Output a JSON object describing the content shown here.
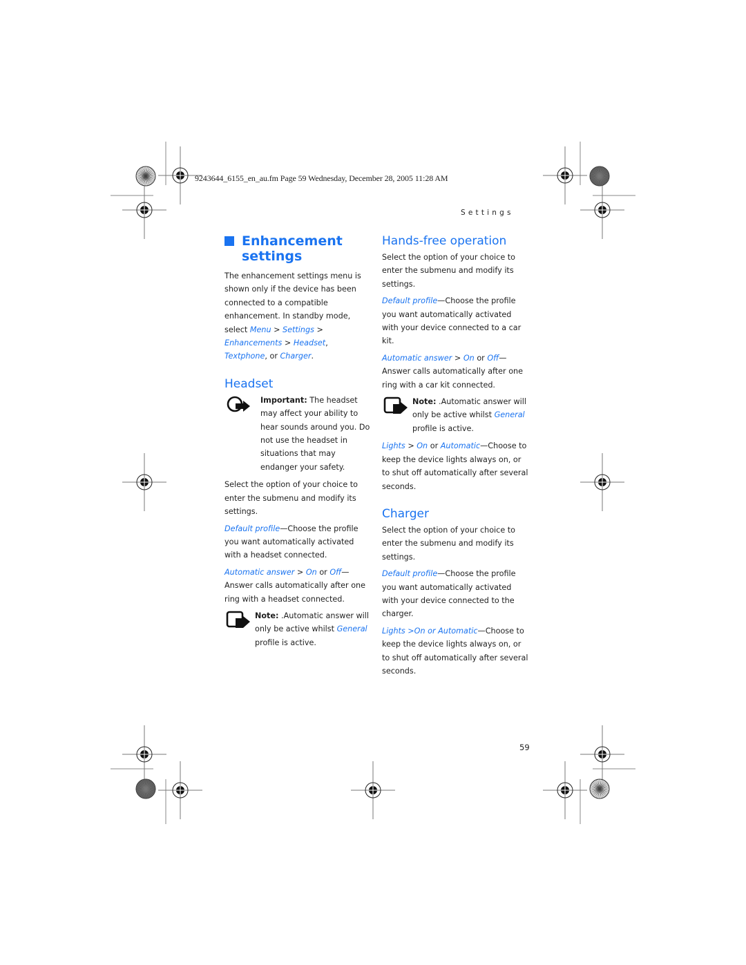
{
  "header": {
    "file_info": "9243644_6155_en_au.fm  Page 59  Wednesday, December 28, 2005  11:28 AM",
    "running_head": "Settings",
    "page_number": "59"
  },
  "colors": {
    "accent": "#1a73f0",
    "text": "#1f1f1f"
  },
  "left_column": {
    "title_line1": "Enhancement",
    "title_line2": "settings",
    "intro": {
      "text": "The enhancement settings menu is shown only if the device has been connected to a compatible enhancement. In standby mode, select",
      "path": [
        "Menu",
        "Settings",
        "Enhancements",
        "Headset",
        "Textphone",
        "Charger"
      ],
      "sep": ">",
      "comma": ",",
      "or": ", or",
      "end": "."
    },
    "headset": {
      "heading": "Headset",
      "important_label": "Important:",
      "important_text": "The headset may affect your ability to hear sounds around you. Do not use the headset in situations that may endanger your safety.",
      "select_text": "Select the option of your choice to enter the submenu and modify its settings.",
      "default_profile_link": "Default profile",
      "default_profile_text": "—Choose the profile you want automatically activated with a headset connected.",
      "auto_answer_link": "Automatic answer",
      "sep": ">",
      "on_link": "On",
      "or": "or",
      "off_link": "Off",
      "auto_answer_text": "— Answer calls automatically after one ring with a headset connected.",
      "note_label": "Note:",
      "note_text_1": ".Automatic answer will only be active whilst",
      "note_link": "General",
      "note_text_2": "profile is active."
    }
  },
  "right_column": {
    "handsfree": {
      "heading": "Hands-free operation",
      "select_text": "Select the option of your choice to enter the submenu and modify its settings.",
      "default_profile_link": "Default profile",
      "default_profile_text": "—Choose the profile you want automatically activated with your device connected to a car kit.",
      "auto_answer_link": "Automatic answer",
      "sep": ">",
      "on_link": "On",
      "or": "or",
      "off_link": "Off",
      "auto_answer_text": "— Answer calls automatically after one ring with a car kit connected.",
      "note_label": "Note:",
      "note_text_1": ".Automatic answer will only be active whilst",
      "note_link": "General",
      "note_text_2": "profile is active.",
      "lights_link": "Lights",
      "lights_on_link": "On",
      "lights_auto_link": "Automatic",
      "lights_text": "—Choose to keep the device lights always on, or to shut off automatically after several seconds."
    },
    "charger": {
      "heading": "Charger",
      "select_text": "Select the option of your choice to enter the submenu and modify its settings.",
      "default_profile_link": "Default profile",
      "default_profile_text": "—Choose the profile you want automatically activated with your device connected to the charger.",
      "lights_link": "Lights >On or Automatic",
      "lights_text": "—Choose to keep the device lights always on, or to shut off automatically after several seconds."
    }
  },
  "icons": {
    "important": "important-arrow-icon",
    "note": "note-hand-icon",
    "registration": "registration-mark-icon",
    "color_wheel": "starburst-target-icon"
  }
}
